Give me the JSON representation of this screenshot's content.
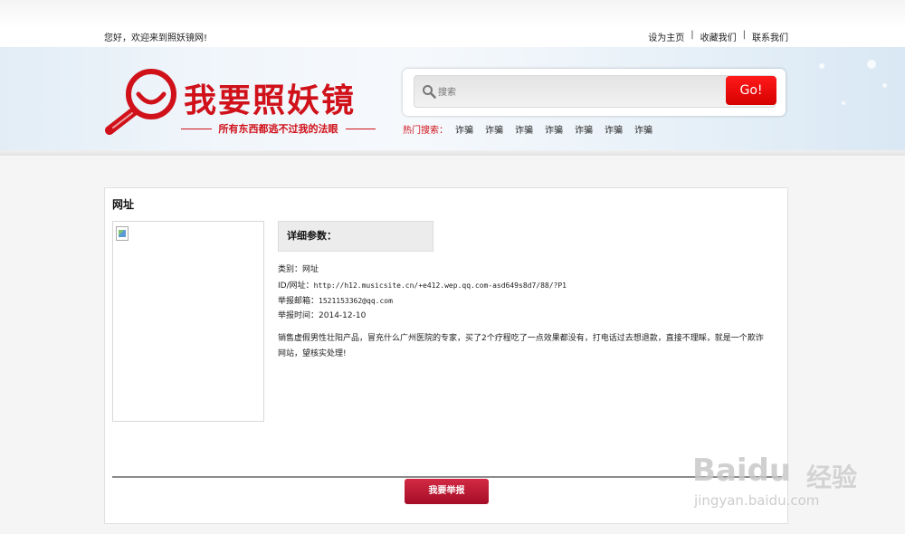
{
  "topbar": {
    "greeting": "您好，欢迎来到照妖镜网!",
    "links": [
      "设为主页",
      "收藏我们",
      "联系我们"
    ],
    "separator": "|"
  },
  "logo": {
    "title": "我要照妖镜",
    "slogan": "所有东西都逃不过我的法眼"
  },
  "search": {
    "placeholder": "搜索",
    "button_label": "Go!"
  },
  "hot_search": {
    "label": "热门搜索：",
    "items": [
      "诈骗",
      "诈骗",
      "诈骗",
      "诈骗",
      "诈骗",
      "诈骗",
      "诈骗"
    ]
  },
  "content": {
    "heading": "网址",
    "params_title": "详细参数：",
    "details": [
      {
        "label": "类别：",
        "value": "网址"
      },
      {
        "label": "ID/网址：",
        "value": "http://h12.musicsite.cn/+e412.wep.qq.com-asd649s8d7/88/?P1"
      },
      {
        "label": "举报邮箱：",
        "value": "1521153362@qq.com"
      },
      {
        "label": "举报时间：",
        "value": "2014-12-10"
      }
    ],
    "description": "销售虚假男性壮阳产品，冒充什么广州医院的专家，买了2个疗程吃了一点效果都没有，打电话过去想退款，直接不理睬，就是一个欺诈网站，望核实处理!",
    "report_button": "我要举报"
  },
  "watermark": {
    "brand": "Baidu",
    "cn": "经验",
    "url": "jingyan.baidu.com"
  },
  "colors": {
    "brand_red": "#d0111a",
    "go_button": "#e00000",
    "report_button": "#b81a33"
  },
  "icons": {
    "search": "magnifier-icon",
    "logo": "magnifier-smile-logo",
    "broken_image": "broken-image-icon"
  }
}
